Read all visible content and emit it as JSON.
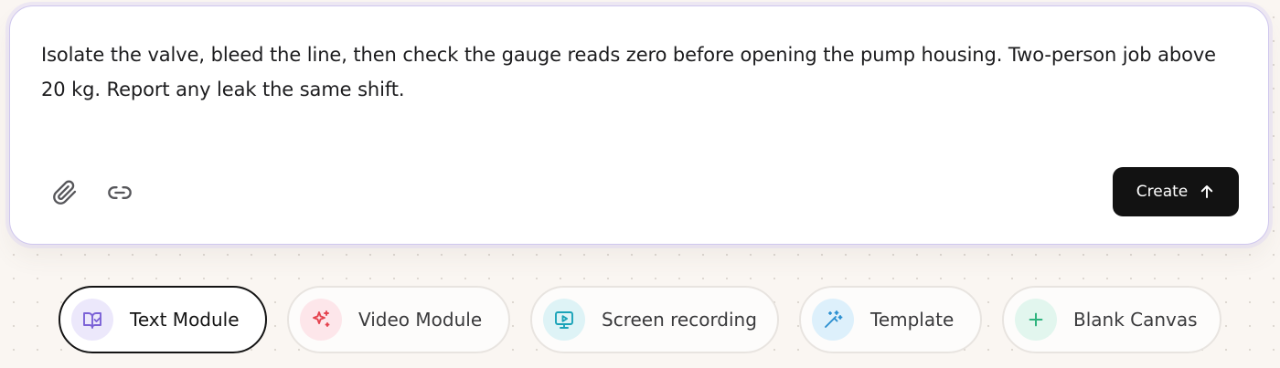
{
  "prompt": {
    "text": "Isolate the valve, bleed the line, then check the gauge reads zero before opening the pump housing. Two-person job above 20 kg. Report any leak the same shift.",
    "tools": [
      {
        "icon": "paperclip-icon"
      },
      {
        "icon": "link-icon"
      }
    ],
    "create_label": "Create",
    "create_icon": "arrow-up-icon"
  },
  "modes": [
    {
      "label": "Text Module",
      "icon": "book-check-icon",
      "active": true,
      "color": "#7b61d6"
    },
    {
      "label": "Video Module",
      "icon": "sparkles-icon",
      "active": false,
      "color": "#e5434f"
    },
    {
      "label": "Screen recording",
      "icon": "monitor-play-icon",
      "active": false,
      "color": "#1aa3b8"
    },
    {
      "label": "Template",
      "icon": "magic-wand-icon",
      "active": false,
      "color": "#2b8fd0"
    },
    {
      "label": "Blank Canvas",
      "icon": "plus-icon",
      "active": false,
      "color": "#2fb37e"
    }
  ],
  "colors": {
    "accent_border": "#cfc7ee",
    "create_button": "#121212",
    "background": "#faf6f2"
  }
}
